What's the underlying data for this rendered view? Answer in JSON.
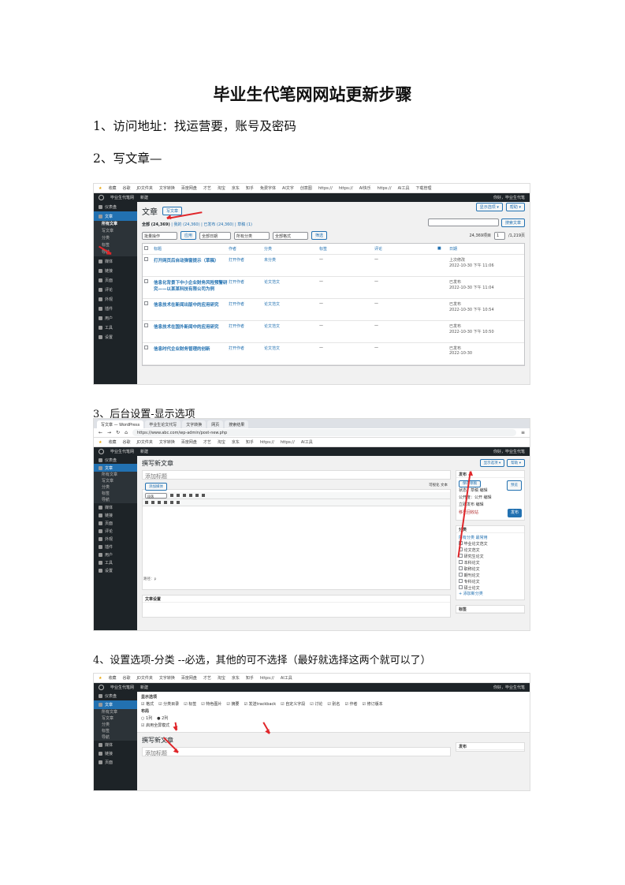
{
  "document": {
    "title": "毕业生代笔网网站更新步骤",
    "step1": "1、访问地址：找运营要，账号及密码",
    "step2": "2、写文章—",
    "step3": "3、后台设置-显示选项",
    "step4": "4、设置选项-分类 --必选，其他的可不选择（最好就选择这两个就可以了）"
  },
  "shot1": {
    "bookmarks": [
      "收藏",
      "谷歌",
      "JD文件夹",
      "文字转换",
      "百度网盘",
      "才艺",
      "淘宝",
      "京东",
      "知乎",
      "免费字体",
      "AI文字",
      "创意图",
      "https://",
      "https://",
      "AI快乐",
      "https://",
      "AI工具",
      "下载管理"
    ],
    "admin_bar": {
      "left": "毕业生代笔网",
      "new": "新建",
      "right": "你好，毕业生代笔"
    },
    "sidebar": {
      "items": [
        "仪表盘",
        "文章"
      ],
      "sub": [
        "所有文章",
        "写文章",
        "分类",
        "标签",
        "导航"
      ],
      "lower": [
        "媒体",
        "链接",
        "页面",
        "评论",
        "外观",
        "插件",
        "用户",
        "工具",
        "设置"
      ]
    },
    "heading": "文章",
    "add_new": "写文章",
    "top_right": [
      "显示选项 ▾",
      "帮助 ▾"
    ],
    "filters": {
      "all": "全部",
      "all_count": "(24,369)",
      "mine": "我的",
      "mine_count": "(24,360)",
      "published": "已发布",
      "published_count": "(24,360)",
      "drafts": "草稿",
      "drafts_count": "(1)"
    },
    "toolbar": {
      "bulk": "批量操作",
      "apply": "应用",
      "dates": "全部日期",
      "cats": "所有分类",
      "format": "全部格式",
      "filter": "筛选",
      "count": "24,369项目",
      "page": "1",
      "pages": "/1,219页"
    },
    "search_button": "搜索文章",
    "columns": [
      "",
      "标题",
      "作者",
      "分类",
      "标签",
      "评论",
      "",
      "日期"
    ],
    "rows": [
      {
        "title": "打开网页后自动弹窗提示（草稿）",
        "author": "打开作者",
        "category": "未分类",
        "tags": "—",
        "comments": "—",
        "status": "上次修改",
        "date": "2022-10-30 下午 11:06"
      },
      {
        "title": "信息化背景下中小企业财务风险预警研究——以某某科技有限公司为例",
        "author": "打开作者",
        "category": "论文范文",
        "tags": "—",
        "comments": "—",
        "status": "已发布",
        "date": "2022-10-30 下午 11:04"
      },
      {
        "title": "信息技术在新闻出版中的应用研究",
        "author": "打开作者",
        "category": "论文范文",
        "tags": "—",
        "comments": "—",
        "status": "已发布",
        "date": "2022-10-30 下午 10:54"
      },
      {
        "title": "信息技术在国外新闻中的应用研究",
        "author": "打开作者",
        "category": "论文范文",
        "tags": "—",
        "comments": "—",
        "status": "已发布",
        "date": "2022-10-30 下午 10:50"
      },
      {
        "title": "信息时代企业财务管理的创新",
        "author": "打开作者",
        "category": "论文范文",
        "tags": "—",
        "comments": "—",
        "status": "已发布",
        "date": "2022-10-30"
      }
    ]
  },
  "shot2": {
    "tabs": [
      "写文章 — WordPress",
      "毕业生论文代写",
      "文字转换",
      "网页",
      "搜索结果"
    ],
    "url": "https://www.abc.com/wp-admin/post-new.php",
    "bookmarks": [
      "收藏",
      "谷歌",
      "JD文件夹",
      "文字转换",
      "百度网盘",
      "才艺",
      "淘宝",
      "京东",
      "知乎",
      "https://",
      "https://",
      "AI工具"
    ],
    "admin_bar": {
      "left": "毕业生代笔网",
      "new": "新建",
      "right": "你好，毕业生代笔"
    },
    "sidebar": [
      "仪表盘",
      "文章",
      "所有文章",
      "写文章",
      "分类",
      "标签",
      "导航",
      "媒体",
      "链接",
      "页面",
      "评论",
      "外观",
      "插件",
      "用户",
      "工具",
      "设置"
    ],
    "heading": "撰写新文章",
    "title_placeholder": "添加标题",
    "add_media": "添加媒体",
    "editor_tabs": [
      "可视化",
      "文本"
    ],
    "para_select": "段落",
    "path": "路径：p",
    "seo_label": "文章设置",
    "top_right": [
      "显示选项 ▾",
      "帮助 ▾"
    ],
    "publish": {
      "title": "发布",
      "save": "保存草稿",
      "preview": "预览",
      "status": "状态：草稿 编辑",
      "visibility": "公开度：公开 编辑",
      "time": "立即发布 编辑",
      "trash": "移至回收站",
      "button": "发布"
    },
    "categories": {
      "title": "分类",
      "tab_all": "所有分类",
      "tab_used": "最常用",
      "items": [
        "毕业论文范文",
        "论文范文",
        "研究生论文",
        "本科论文",
        "职称论文",
        "期刊论文",
        "专科论文",
        "硕士论文"
      ],
      "add": "+ 添加新分类"
    },
    "tags_box": "标签"
  },
  "shot3": {
    "bookmarks": [
      "收藏",
      "谷歌",
      "JD文件夹",
      "文字转换",
      "百度网盘",
      "才艺",
      "淘宝",
      "京东",
      "知乎",
      "https://",
      "AI工具"
    ],
    "admin_bar": {
      "left": "毕业生代笔网",
      "new": "新建",
      "right": "你好，毕业生代笔"
    },
    "sidebar": [
      "仪表盘",
      "文章",
      "所有文章",
      "写文章",
      "分类",
      "标签",
      "导航",
      "媒体",
      "链接",
      "页面"
    ],
    "options_title": "显示选项",
    "options_row": [
      "格式",
      "分类目录",
      "标签",
      "特色图片",
      "摘要",
      "发送trackback",
      "自定义字段",
      "讨论",
      "别名",
      "作者",
      "修订版本"
    ],
    "layout_label": "布局",
    "layout_opts": [
      "1列",
      "2列"
    ],
    "extra": "启用全屏模式",
    "heading": "撰写新文章",
    "title_placeholder": "添加标题",
    "publish_box": "发布"
  }
}
